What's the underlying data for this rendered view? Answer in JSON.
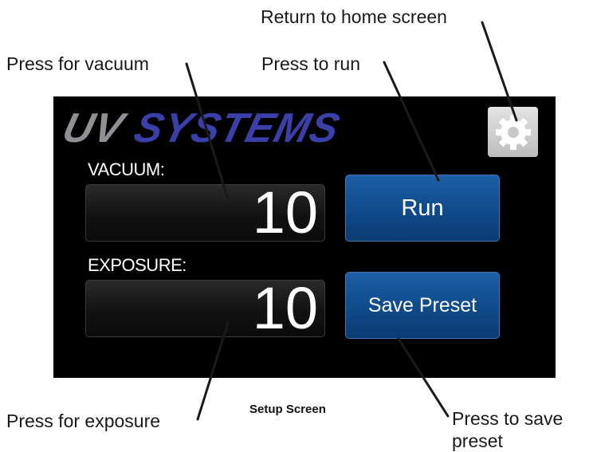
{
  "annotations": {
    "home": "Return to home screen",
    "vacuum": "Press for vacuum",
    "run": "Press to run",
    "exposure": "Press for exposure",
    "save_line1": "Press to save",
    "save_line2": "preset"
  },
  "caption": "Setup Screen",
  "screen": {
    "logo_part1": "UV",
    "logo_part2": "SYSTEMS",
    "vacuum_label": "VACUUM:",
    "vacuum_value": "10",
    "exposure_label": "EXPOSURE:",
    "exposure_value": "10",
    "run_label": "Run",
    "save_label": "Save Preset",
    "settings_icon": "gear-icon"
  },
  "colors": {
    "screen_bg": "#000000",
    "button_blue": "#0f4a8a",
    "logo_grey": "#8f9093",
    "logo_blue": "#3b3fa8"
  }
}
